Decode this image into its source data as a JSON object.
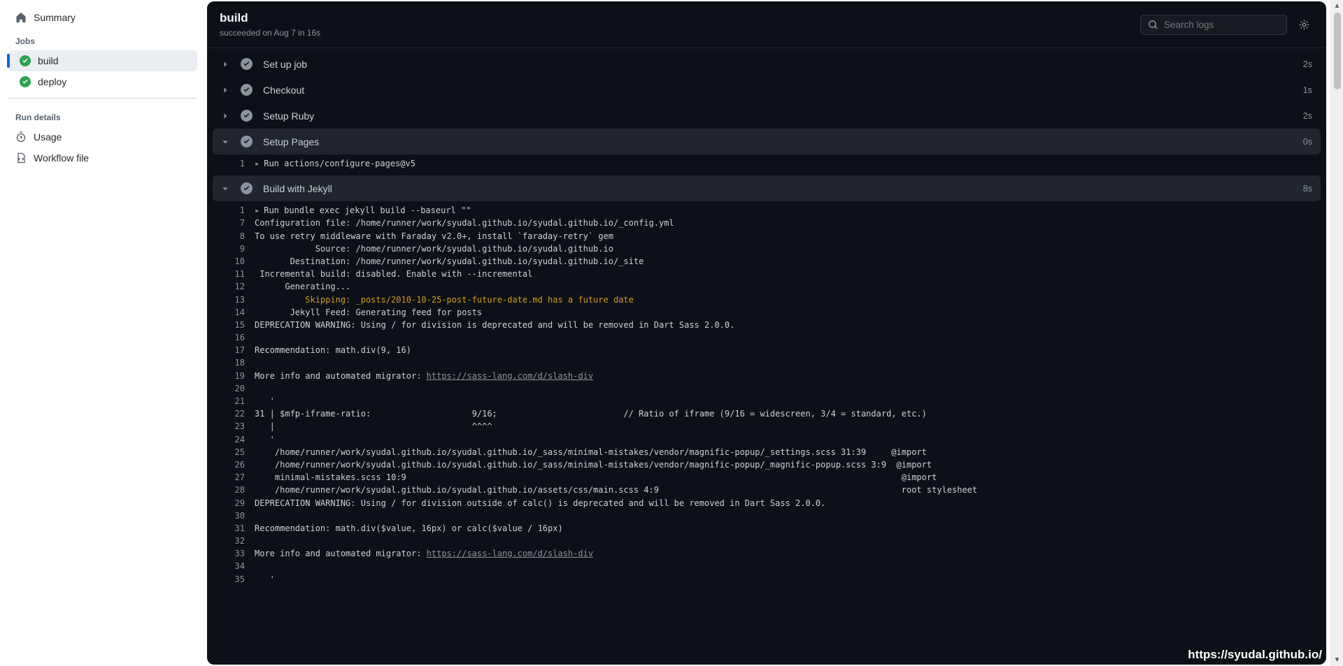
{
  "sidebar": {
    "summary": "Summary",
    "jobs_heading": "Jobs",
    "jobs": [
      {
        "label": "build",
        "active": true
      },
      {
        "label": "deploy",
        "active": false
      }
    ],
    "run_details_heading": "Run details",
    "usage": "Usage",
    "workflow_file": "Workflow file"
  },
  "header": {
    "title": "build",
    "subtitle": "succeeded on Aug 7 in 16s",
    "search_placeholder": "Search logs"
  },
  "steps": [
    {
      "name": "Set up job",
      "duration": "2s",
      "expanded": false
    },
    {
      "name": "Checkout",
      "duration": "1s",
      "expanded": false
    },
    {
      "name": "Setup Ruby",
      "duration": "2s",
      "expanded": false
    },
    {
      "name": "Setup Pages",
      "duration": "0s",
      "expanded": true,
      "lines": [
        {
          "n": "1",
          "run": true,
          "text": "Run actions/configure-pages@v5"
        }
      ]
    },
    {
      "name": "Build with Jekyll",
      "duration": "8s",
      "expanded": true,
      "lines": [
        {
          "n": "1",
          "run": true,
          "text": "Run bundle exec jekyll build --baseurl \"\""
        },
        {
          "n": "7",
          "text": "Configuration file: /home/runner/work/syudal.github.io/syudal.github.io/_config.yml"
        },
        {
          "n": "8",
          "text": "To use retry middleware with Faraday v2.0+, install `faraday-retry` gem"
        },
        {
          "n": "9",
          "text": "            Source: /home/runner/work/syudal.github.io/syudal.github.io"
        },
        {
          "n": "10",
          "text": "       Destination: /home/runner/work/syudal.github.io/syudal.github.io/_site"
        },
        {
          "n": "11",
          "text": " Incremental build: disabled. Enable with --incremental"
        },
        {
          "n": "12",
          "text": "      Generating..."
        },
        {
          "n": "13",
          "warn": true,
          "text": "          Skipping: _posts/2010-10-25-post-future-date.md has a future date"
        },
        {
          "n": "14",
          "text": "       Jekyll Feed: Generating feed for posts"
        },
        {
          "n": "15",
          "text": "DEPRECATION WARNING: Using / for division is deprecated and will be removed in Dart Sass 2.0.0."
        },
        {
          "n": "16",
          "text": ""
        },
        {
          "n": "17",
          "text": "Recommendation: math.div(9, 16)"
        },
        {
          "n": "18",
          "text": ""
        },
        {
          "n": "19",
          "link": "https://sass-lang.com/d/slash-div",
          "text": "More info and automated migrator: "
        },
        {
          "n": "20",
          "text": ""
        },
        {
          "n": "21",
          "text": "   '"
        },
        {
          "n": "22",
          "text": "31 | $mfp-iframe-ratio:                    9/16;                         // Ratio of iframe (9/16 = widescreen, 3/4 = standard, etc.)"
        },
        {
          "n": "23",
          "text": "   |                                       ^^^^"
        },
        {
          "n": "24",
          "text": "   '"
        },
        {
          "n": "25",
          "text": "    /home/runner/work/syudal.github.io/syudal.github.io/_sass/minimal-mistakes/vendor/magnific-popup/_settings.scss 31:39     @import"
        },
        {
          "n": "26",
          "text": "    /home/runner/work/syudal.github.io/syudal.github.io/_sass/minimal-mistakes/vendor/magnific-popup/_magnific-popup.scss 3:9  @import"
        },
        {
          "n": "27",
          "text": "    minimal-mistakes.scss 10:9                                                                                                  @import"
        },
        {
          "n": "28",
          "text": "    /home/runner/work/syudal.github.io/syudal.github.io/assets/css/main.scss 4:9                                                root stylesheet"
        },
        {
          "n": "29",
          "text": "DEPRECATION WARNING: Using / for division outside of calc() is deprecated and will be removed in Dart Sass 2.0.0."
        },
        {
          "n": "30",
          "text": ""
        },
        {
          "n": "31",
          "text": "Recommendation: math.div($value, 16px) or calc($value / 16px)"
        },
        {
          "n": "32",
          "text": ""
        },
        {
          "n": "33",
          "link": "https://sass-lang.com/d/slash-div",
          "text": "More info and automated migrator: "
        },
        {
          "n": "34",
          "text": ""
        },
        {
          "n": "35",
          "text": "   '"
        }
      ]
    }
  ],
  "footer_url": "https://syudal.github.io/"
}
